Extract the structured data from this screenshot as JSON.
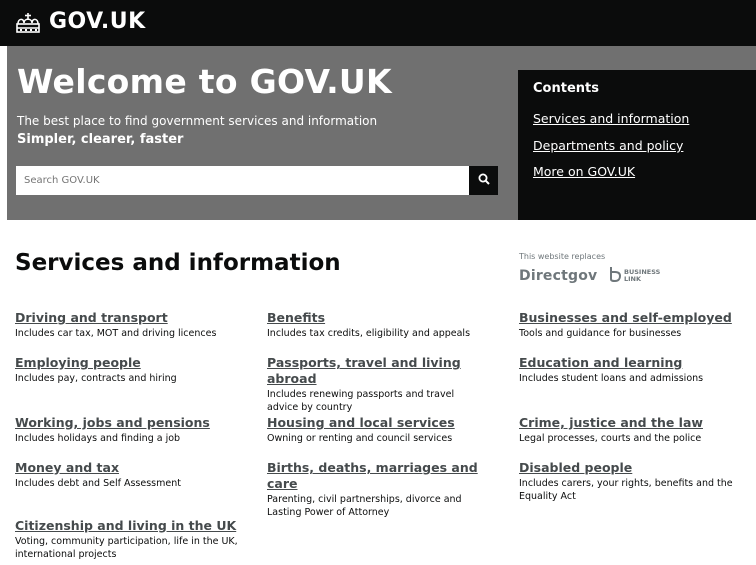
{
  "header": {
    "logo_text": "GOV.UK",
    "logo_icon": "crown-icon"
  },
  "hero": {
    "title": "Welcome to GOV.UK",
    "subtitle": "The best place to find government services and information",
    "tagline": "Simpler, clearer, faster",
    "search_placeholder": "Search GOV.UK",
    "search_icon": "search-icon"
  },
  "contents": {
    "title": "Contents",
    "links": [
      "Services and information",
      "Departments and policy",
      "More on GOV.UK"
    ]
  },
  "services": {
    "title": "Services and information",
    "replaces_label": "This website replaces",
    "directgov": "Directgov",
    "businesslink_line1": "BUSINESS",
    "businesslink_line2": "LINK",
    "topics": [
      {
        "label": "Driving and transport",
        "desc": "Includes car tax, MOT and driving licences"
      },
      {
        "label": "Benefits",
        "desc": "Includes tax credits, eligibility and appeals"
      },
      {
        "label": "Businesses and self-employed",
        "desc": "Tools and guidance for businesses"
      },
      {
        "label": "Employing people",
        "desc": "Includes pay, contracts and hiring"
      },
      {
        "label": "Passports, travel and living abroad",
        "desc": "Includes renewing passports and travel advice by country"
      },
      {
        "label": "Education and learning",
        "desc": "Includes student loans and admissions"
      },
      {
        "label": "Working, jobs and pensions",
        "desc": "Includes holidays and finding a job"
      },
      {
        "label": "Housing and local services",
        "desc": "Owning or renting and council services"
      },
      {
        "label": "Crime, justice and the law",
        "desc": "Legal processes, courts and the police"
      },
      {
        "label": "Money and tax",
        "desc": "Includes debt and Self Assessment"
      },
      {
        "label": "Births, deaths, marriages and care",
        "desc": "Parenting, civil partnerships, divorce and Lasting Power of Attorney"
      },
      {
        "label": "Disabled people",
        "desc": "Includes carers, your rights, benefits and the Equality Act"
      },
      {
        "label": "Citizenship and living in the UK",
        "desc": "Voting, community participation, life in the UK, international projects"
      }
    ]
  },
  "colors": {
    "header_bg": "#0b0c0c",
    "hero_bg": "#707070",
    "link": "#454a4c",
    "text": "#0b0c0c"
  }
}
